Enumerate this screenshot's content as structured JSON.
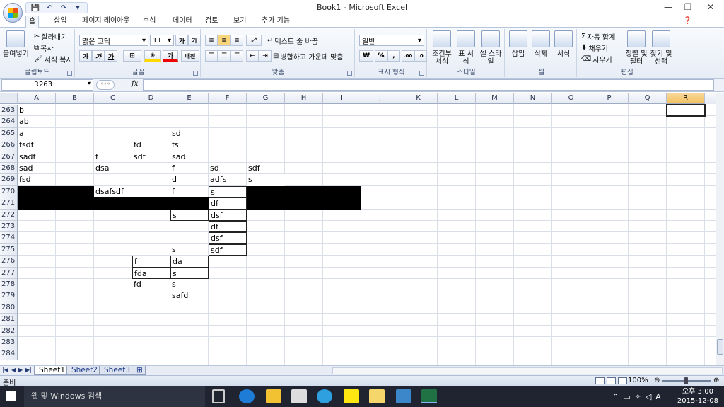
{
  "window": {
    "title": "Book1 - Microsoft Excel",
    "min": "—",
    "restore": "❐",
    "close": "✕"
  },
  "qat": {
    "save": "💾",
    "undo": "↶",
    "redo": "↷",
    "more": "▾"
  },
  "ribbon_tabs": [
    "홈",
    "삽입",
    "페이지 레이아웃",
    "수식",
    "데이터",
    "검토",
    "보기",
    "추가 기능"
  ],
  "ribbon": {
    "clipboard": {
      "label": "클립보드",
      "paste": "붙여넣기",
      "cut": "잘라내기",
      "copy": "복사",
      "format_painter": "서식 복사"
    },
    "font": {
      "label": "글꼴",
      "name": "맑은 고딕",
      "size": "11",
      "bold": "가",
      "italic": "가",
      "underline": "가",
      "grow": "가",
      "shrink": "가",
      "hangul": "내천"
    },
    "alignment": {
      "label": "맞춤",
      "wrap": "텍스트 줄 바꿈",
      "merge": "병합하고 가운데 맞춤"
    },
    "number": {
      "label": "표시 형식",
      "format": "일반",
      "currency": "₩",
      "percent": "%",
      "comma": ",",
      "inc": ".00",
      "dec": ".0"
    },
    "styles": {
      "label": "스타일",
      "conditional": "조건부 서식",
      "table": "표 서식",
      "cell": "셀 스타일"
    },
    "cells": {
      "label": "셀",
      "insert": "삽입",
      "delete": "삭제",
      "format": "서식"
    },
    "editing": {
      "label": "편집",
      "autosum": "자동 합계",
      "fill": "채우기",
      "clear": "지우기",
      "sort": "정렬 및 필터",
      "find": "찾기 및 선택"
    }
  },
  "formula_bar": {
    "name_box": "R263",
    "fx": "fx",
    "value": ""
  },
  "columns": [
    "A",
    "B",
    "C",
    "D",
    "E",
    "F",
    "G",
    "H",
    "I",
    "J",
    "K",
    "L",
    "M",
    "N",
    "O",
    "P",
    "Q",
    "R"
  ],
  "selected_column": "R",
  "rows": [
    "263",
    "264",
    "265",
    "266",
    "267",
    "268",
    "269",
    "270",
    "271",
    "272",
    "273",
    "274",
    "275",
    "276",
    "277",
    "278",
    "279",
    "280",
    "281",
    "282",
    "283",
    "284"
  ],
  "cells": {
    "A263": "b",
    "A264": "ab",
    "A265": "a",
    "E265": "sd",
    "A266": "fsdf",
    "D266": "fd",
    "E266": "fs",
    "A267": "sadf",
    "C267": "f",
    "D267": "sdf",
    "E267": "sad",
    "A268": "sad",
    "C268": "dsa",
    "E268": "f",
    "F268": "sd",
    "G268": "sdf",
    "A269": "fsd",
    "E269": "d",
    "F269": "adfs",
    "G269": "s",
    "C270": "dsafsdf",
    "E270": "f",
    "F270": "s",
    "F271": "df",
    "E272": "s",
    "F272": "dsf",
    "F273": "df",
    "F274": "dsf",
    "E275": "s",
    "F275": "sdf",
    "D276": "f",
    "E276": "da",
    "D277": "fda",
    "E277": "s",
    "D278": "fd",
    "E278": "s",
    "E279": "safd"
  },
  "sheets": [
    "Sheet1",
    "Sheet2",
    "Sheet3"
  ],
  "active_sheet": "Sheet1",
  "status": {
    "ready": "준비",
    "zoom": "100%",
    "minus": "⊖",
    "plus": "⊕"
  },
  "taskbar": {
    "search": "웹 및 Windows 검색",
    "time": "오후 3:00",
    "date": "2015-12-08",
    "lang": "A"
  }
}
